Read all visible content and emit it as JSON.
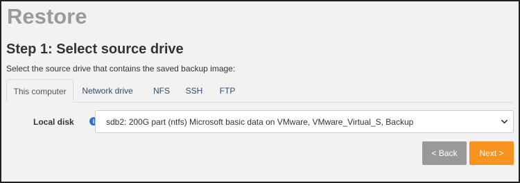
{
  "header": {
    "app_title": "Restore"
  },
  "step": {
    "title": "Step 1: Select source drive",
    "description": "Select the source drive that contains the saved backup image:"
  },
  "tabs": [
    {
      "label": "This computer",
      "active": true
    },
    {
      "label": "Network drive",
      "active": false
    },
    {
      "label": "NFS",
      "active": false
    },
    {
      "label": "SSH",
      "active": false
    },
    {
      "label": "FTP",
      "active": false
    }
  ],
  "local_disk": {
    "label": "Local disk",
    "info_icon": "info-icon",
    "selected_value": "sdb2: 200G part (ntfs) Microsoft basic data on VMware, VMware_Virtual_S, Backup"
  },
  "buttons": {
    "back_label": "< Back",
    "next_label": "Next >"
  },
  "colors": {
    "accent_next": "#f7931e",
    "back_button": "#999999",
    "tab_link": "#2b4d75",
    "info_icon": "#2f6fcf"
  }
}
